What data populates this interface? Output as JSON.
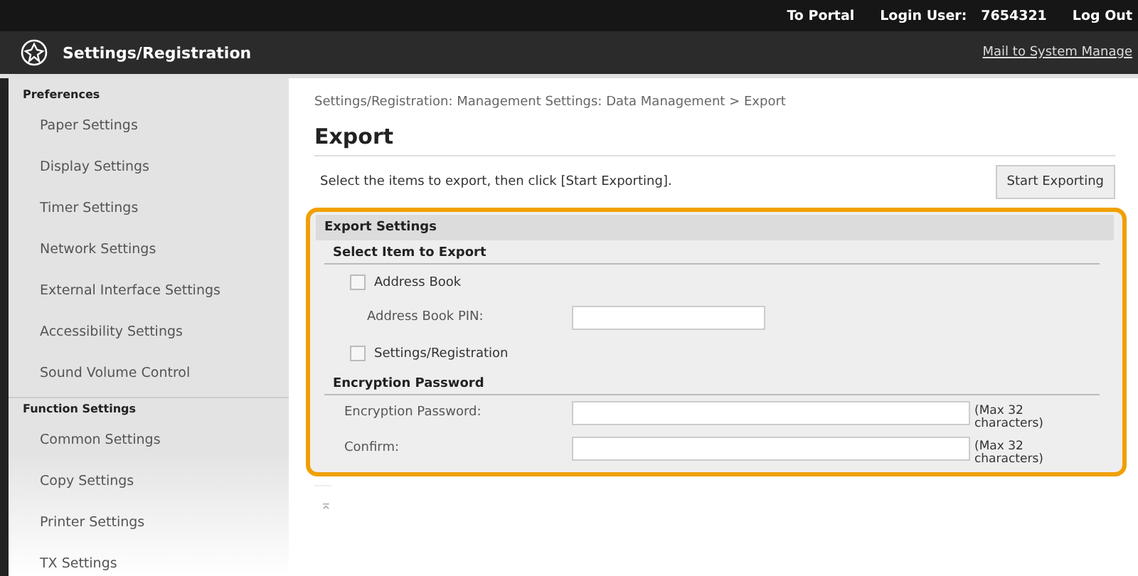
{
  "top_bar": {
    "links": [
      "To Portal"
    ],
    "login_label": "Login User:",
    "login_user": "7654321",
    "logout": "Log Out"
  },
  "header": {
    "title": "Settings/Registration",
    "mail_link": "Mail to System Manage"
  },
  "sidebar": {
    "sections": [
      {
        "title": "Preferences",
        "items": [
          "Paper Settings",
          "Display Settings",
          "Timer Settings",
          "Network Settings",
          "External Interface Settings",
          "Accessibility Settings",
          "Sound Volume Control"
        ]
      },
      {
        "title": "Function Settings",
        "items": [
          "Common Settings",
          "Copy Settings",
          "Printer Settings",
          "TX Settings"
        ]
      }
    ]
  },
  "breadcrumb": "Settings/Registration: Management Settings: Data Management > Export",
  "page_title": "Export",
  "instruction": "Select the items to export, then click [Start Exporting].",
  "start_button": "Start Exporting",
  "panel": {
    "title": "Export Settings",
    "groups": [
      {
        "title": "Select Item to Export",
        "rows": [
          {
            "kind": "checkbox",
            "label": "Address Book",
            "checked": false
          },
          {
            "kind": "short_field",
            "label": "Address Book PIN:"
          },
          {
            "kind": "checkbox",
            "label": "Settings/Registration",
            "checked": false
          }
        ]
      },
      {
        "title": "Encryption Password",
        "rows": [
          {
            "kind": "field",
            "label": "Encryption Password:",
            "note": "(Max 32 characters)"
          },
          {
            "kind": "field",
            "label": "Confirm:",
            "note": "(Max 32 characters)"
          }
        ]
      }
    ]
  },
  "back_to_top": "⌅"
}
